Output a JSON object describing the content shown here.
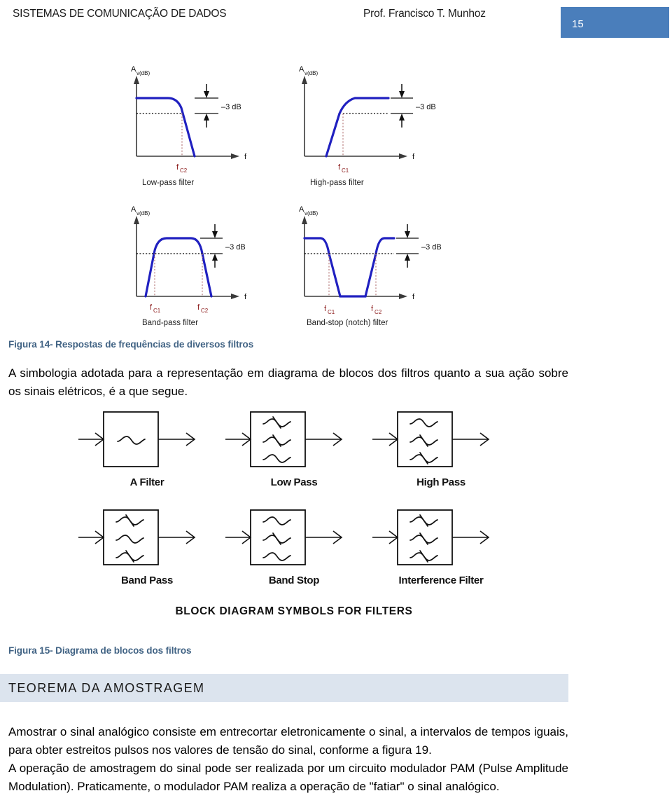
{
  "header": {
    "course_title": "SISTEMAS DE COMUNICAÇÃO DE DADOS",
    "author": "Prof. Francisco T. Munhoz",
    "page_number": "15",
    "accent_color": "#4A7EBB"
  },
  "figure14": {
    "caption": "Figura 14- Respostas de frequências de diversos filtros",
    "curve_color": "#2020C0",
    "cutoff_label_color": "#8B1A1A",
    "axis_color": "#3a3a3a",
    "panels": [
      {
        "id": "low-pass",
        "title": "Low-pass filter",
        "y_axis_label": "A",
        "y_axis_sub": "v(dB)",
        "x_axis_label": "f",
        "db_label": "–3 dB",
        "cutoffs": [
          "f",
          "C2"
        ],
        "cutoff_display": "fC2"
      },
      {
        "id": "high-pass",
        "title": "High-pass filter",
        "y_axis_label": "A",
        "y_axis_sub": "v(dB)",
        "x_axis_label": "f",
        "db_label": "–3 dB",
        "cutoff_display": "fC1"
      },
      {
        "id": "band-pass",
        "title": "Band-pass filter",
        "y_axis_label": "A",
        "y_axis_sub": "v(dB)",
        "x_axis_label": "f",
        "db_label": "–3 dB",
        "cutoff_display_1": "fC1",
        "cutoff_display_2": "fC2"
      },
      {
        "id": "band-stop",
        "title": "Band-stop (notch) filter",
        "y_axis_label": "A",
        "y_axis_sub": "v(dB)",
        "x_axis_label": "f",
        "db_label": "–3 dB",
        "cutoff_display_1": "fC1",
        "cutoff_display_2": "fC2"
      }
    ]
  },
  "paragraphs": {
    "simbologia": "A simbologia adotada para a representação em diagrama de blocos dos filtros quanto a sua ação sobre os sinais elétricos, é a que segue.",
    "amostrar": "Amostrar o sinal analógico consiste em entrecortar eletronicamente o sinal, a intervalos de tempos iguais, para obter estreitos pulsos nos valores de tensão do sinal, conforme a figura 19.",
    "pam": "A operação de amostragem do sinal pode ser realizada por um circuito modulador PAM (Pulse Amplitude Modulation). Praticamente, o modulador PAM realiza a operação de \"fatiar\" o sinal analógico."
  },
  "figure15": {
    "caption": "Figura 15- Diagrama de blocos dos filtros",
    "title": "BLOCK DIAGRAM SYMBOLS FOR FILTERS",
    "blocks": [
      {
        "id": "a-filter",
        "label": "A Filter",
        "waves": [
          "pass"
        ]
      },
      {
        "id": "low-pass",
        "label": "Low Pass",
        "waves": [
          "block",
          "block",
          "pass"
        ]
      },
      {
        "id": "high-pass",
        "label": "High Pass",
        "waves": [
          "pass",
          "block",
          "block"
        ]
      },
      {
        "id": "band-pass",
        "label": "Band Pass",
        "waves": [
          "block",
          "pass",
          "block"
        ]
      },
      {
        "id": "band-stop",
        "label": "Band Stop",
        "waves": [
          "pass",
          "block",
          "pass"
        ]
      },
      {
        "id": "interference-filter",
        "label": "Interference Filter",
        "waves": [
          "block",
          "block",
          "block"
        ]
      }
    ]
  },
  "section": {
    "heading": "TEOREMA DA AMOSTRAGEM",
    "band_color": "#DCE4EE"
  }
}
